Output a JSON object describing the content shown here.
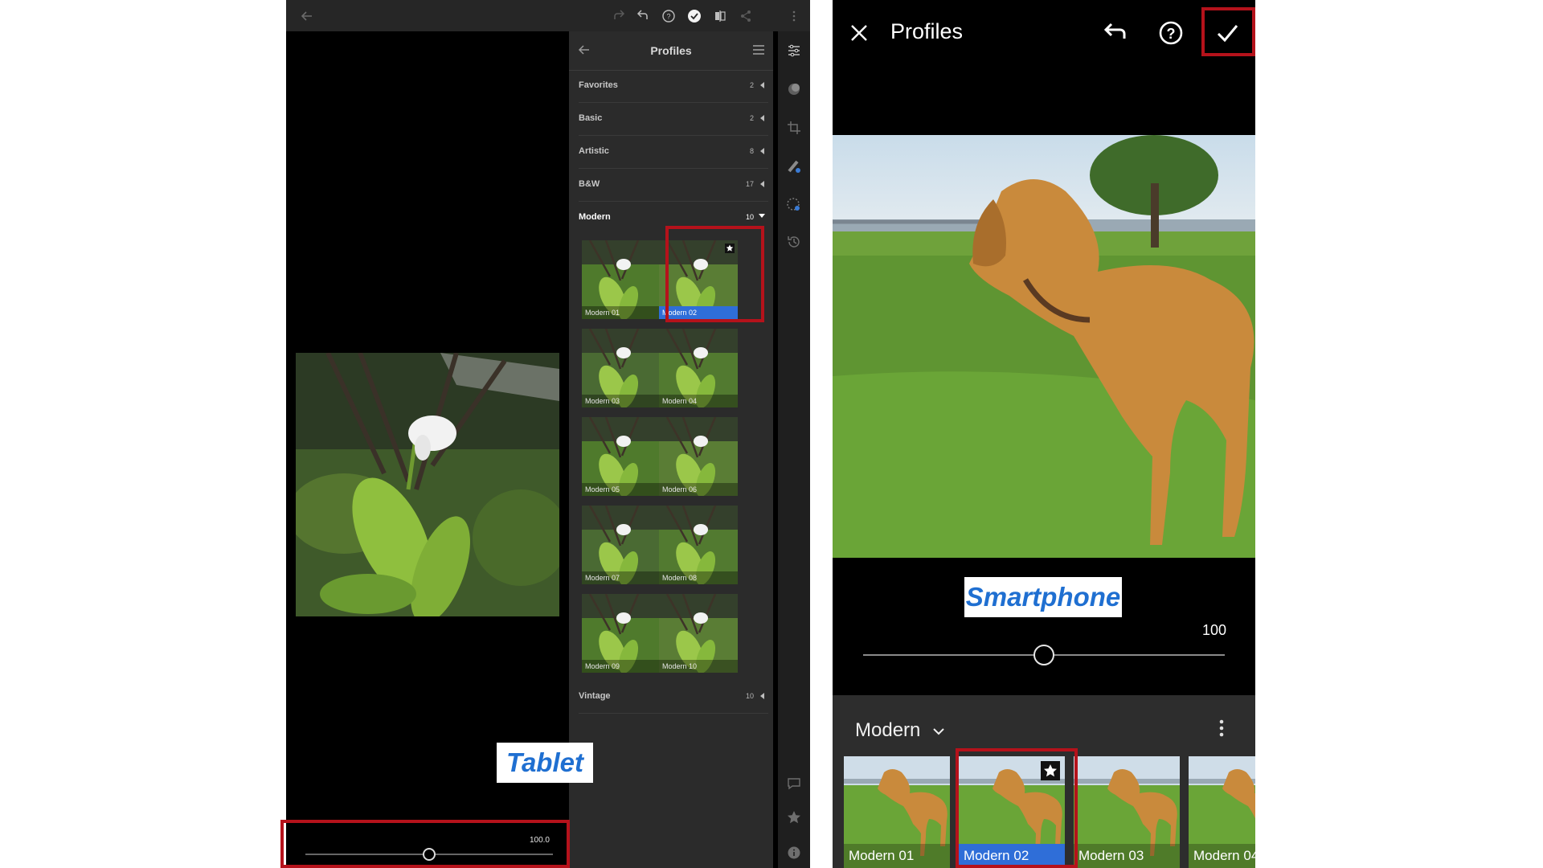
{
  "tablet": {
    "panel_title": "Profiles",
    "categories": [
      {
        "label": "Favorites",
        "count": "2"
      },
      {
        "label": "Basic",
        "count": "2"
      },
      {
        "label": "Artistic",
        "count": "8"
      },
      {
        "label": "B&W",
        "count": "17"
      },
      {
        "label": "Modern",
        "count": "10"
      },
      {
        "label": "Vintage",
        "count": "10"
      }
    ],
    "profiles": [
      "Modern 01",
      "Modern 02",
      "Modern 03",
      "Modern 04",
      "Modern 05",
      "Modern 06",
      "Modern 07",
      "Modern 08",
      "Modern 09",
      "Modern 10"
    ],
    "selected_profile": "Modern 02",
    "amount": "100.0",
    "amount_fraction": 0.5,
    "caption": "Tablet"
  },
  "phone": {
    "title": "Profiles",
    "amount": "100",
    "amount_fraction": 0.5,
    "group": "Modern",
    "profiles": [
      "Modern 01",
      "Modern 02",
      "Modern 03",
      "Modern 04"
    ],
    "selected_profile": "Modern 02",
    "caption": "Smartphone"
  },
  "colors": {
    "highlight": "#b5121b",
    "accent": "#2f6ed8",
    "caption_text": "#1f6fd1"
  }
}
